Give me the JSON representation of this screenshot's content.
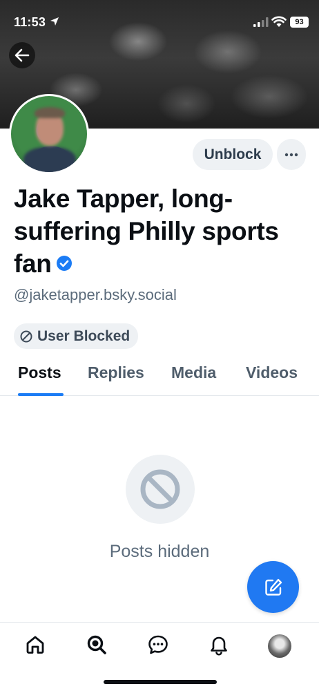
{
  "status_bar": {
    "time": "11:53",
    "battery": "93"
  },
  "profile": {
    "display_name": "Jake Tapper, long-suffering Philly sports fan",
    "handle": "@jaketapper.bsky.social",
    "verified": true,
    "unblock_label": "Unblock",
    "blocked_badge": "User Blocked"
  },
  "tabs": [
    {
      "label": "Posts",
      "active": true
    },
    {
      "label": "Replies",
      "active": false
    },
    {
      "label": "Media",
      "active": false
    },
    {
      "label": "Videos",
      "active": false
    }
  ],
  "content": {
    "hidden_message": "Posts hidden"
  },
  "bottom_nav": [
    {
      "icon": "home-icon"
    },
    {
      "icon": "search-icon"
    },
    {
      "icon": "chat-icon"
    },
    {
      "icon": "bell-icon"
    },
    {
      "icon": "profile-avatar"
    }
  ],
  "colors": {
    "accent": "#2079f2",
    "verified": "#1b7cf5",
    "pill_bg": "#eef1f4",
    "muted_text": "#5b6b7b"
  }
}
